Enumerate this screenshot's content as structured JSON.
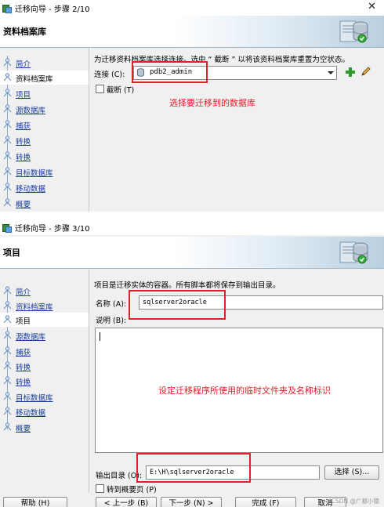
{
  "top": {
    "window_title": "迁移向导 - 步骤 2/10",
    "header_title": "资料档案库",
    "nav": [
      {
        "label": "简介",
        "active": false
      },
      {
        "label": "资料档案库",
        "active": true
      },
      {
        "label": "项目",
        "active": false
      },
      {
        "label": "源数据库",
        "active": false
      },
      {
        "label": "捕获",
        "active": false
      },
      {
        "label": "转换",
        "active": false
      },
      {
        "label": "转换",
        "active": false
      },
      {
        "label": "目标数据库",
        "active": false
      },
      {
        "label": "移动数据",
        "active": false
      },
      {
        "label": "概要",
        "active": false
      }
    ],
    "description": "为迁移资料档案库选择连接。选中 “ 截断 ” 以将该资料档案库重置为空状态。",
    "connection_label": "连接 (C):",
    "connection_value": "pdb2_admin",
    "truncate_label": "截断 (T)",
    "annotation": "选择要迁移到的数据库"
  },
  "bottom": {
    "window_title": "迁移向导 - 步骤 3/10",
    "header_title": "项目",
    "nav": [
      {
        "label": "简介",
        "active": false
      },
      {
        "label": "资料档案库",
        "active": false
      },
      {
        "label": "项目",
        "active": true
      },
      {
        "label": "源数据库",
        "active": false
      },
      {
        "label": "捕获",
        "active": false
      },
      {
        "label": "转换",
        "active": false
      },
      {
        "label": "转换",
        "active": false
      },
      {
        "label": "目标数据库",
        "active": false
      },
      {
        "label": "移动数据",
        "active": false
      },
      {
        "label": "概要",
        "active": false
      }
    ],
    "description": "项目是迁移实体的容器。所有脚本都将保存到输出目录。",
    "name_label": "名称 (A):",
    "name_value": "sqlserver2oracle",
    "comment_label": "说明 (B):",
    "annotation": "设定迁移程序所使用的临时文件夹及名称标识",
    "output_dir_label": "输出目录 (O):",
    "output_dir_value": "E:\\H\\sqlserver2oracle",
    "choose_button": "选择 (S)...",
    "goto_summary_label": "转到概要页 (P)",
    "footer_buttons": [
      "帮助 (H)",
      "< 上一步 (B)",
      "下一步 (N) >",
      "完成 (F)",
      "取消"
    ]
  },
  "watermark": "CSDN @广都小猿",
  "colors": {
    "annotation_red": "#e0202a",
    "link_blue": "#1a3d9c",
    "add_green": "#2f9a2f"
  }
}
